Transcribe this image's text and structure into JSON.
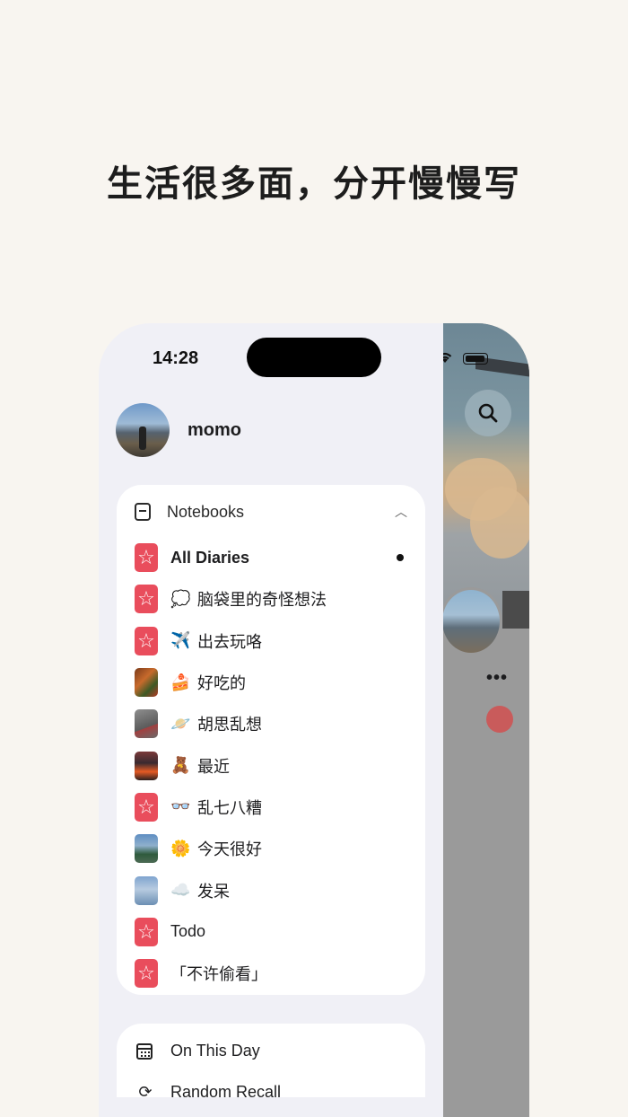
{
  "headline": "生活很多面，分开慢慢写",
  "status_bar": {
    "time": "14:28"
  },
  "profile": {
    "name": "momo"
  },
  "notebooks": {
    "header": "Notebooks",
    "items": [
      {
        "emoji": "",
        "name": "All Diaries",
        "thumb": "star",
        "active": true
      },
      {
        "emoji": "💭",
        "name": "脑袋里的奇怪想法",
        "thumb": "star"
      },
      {
        "emoji": "✈️",
        "name": "出去玩咯",
        "thumb": "star"
      },
      {
        "emoji": "🍰",
        "name": "好吃的",
        "thumb": "food"
      },
      {
        "emoji": "🪐",
        "name": "胡思乱想",
        "thumb": "rock"
      },
      {
        "emoji": "🧸",
        "name": "最近",
        "thumb": "volcano"
      },
      {
        "emoji": "👓",
        "name": "乱七八糟",
        "thumb": "star"
      },
      {
        "emoji": "🌼",
        "name": "今天很好",
        "thumb": "lake"
      },
      {
        "emoji": "☁️",
        "name": "发呆",
        "thumb": "sky2"
      },
      {
        "emoji": "",
        "name": "Todo",
        "thumb": "star"
      },
      {
        "emoji": "",
        "name": "「不许偷看」",
        "thumb": "star"
      }
    ]
  },
  "menu": {
    "on_this_day": "On This Day",
    "random_recall": "Random Recall"
  },
  "background_screen": {
    "more_label": "•••"
  },
  "icons": {
    "search": "search-icon",
    "notebook": "notebook-icon",
    "chevron": "chevron-up-icon",
    "calendar": "calendar-icon",
    "refresh": "refresh-icon",
    "star": "star-icon"
  },
  "colors": {
    "accent": "#e94d5c",
    "background": "#f8f5f0",
    "drawer": "#f0f0f6"
  }
}
